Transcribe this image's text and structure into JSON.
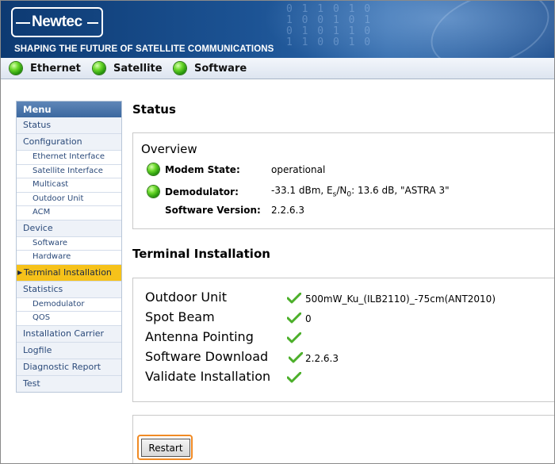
{
  "brand": {
    "logo": "Newtec",
    "tagline": "SHAPING THE FUTURE OF SATELLITE COMMUNICATIONS"
  },
  "status_strip": [
    {
      "label": "Ethernet",
      "state": "green"
    },
    {
      "label": "Satellite",
      "state": "green"
    },
    {
      "label": "Software",
      "state": "green"
    }
  ],
  "menu": {
    "title": "Menu",
    "items": [
      {
        "label": "Status",
        "level": 0
      },
      {
        "label": "Configuration",
        "level": 0
      },
      {
        "label": "Ethernet Interface",
        "level": 1
      },
      {
        "label": "Satellite Interface",
        "level": 1
      },
      {
        "label": "Multicast",
        "level": 1
      },
      {
        "label": "Outdoor Unit",
        "level": 1
      },
      {
        "label": "ACM",
        "level": 1
      },
      {
        "label": "Device",
        "level": 0
      },
      {
        "label": "Software",
        "level": 1
      },
      {
        "label": "Hardware",
        "level": 1
      },
      {
        "label": "Terminal Installation",
        "level": 0,
        "active": true
      },
      {
        "label": "Statistics",
        "level": 0
      },
      {
        "label": "Demodulator",
        "level": 1
      },
      {
        "label": "QOS",
        "level": 1
      },
      {
        "label": "Installation Carrier",
        "level": 0
      },
      {
        "label": "Logfile",
        "level": 0
      },
      {
        "label": "Diagnostic Report",
        "level": 0
      },
      {
        "label": "Test",
        "level": 0
      }
    ]
  },
  "status": {
    "heading": "Status",
    "overview_title": "Overview",
    "modem_state_label": "Modem State:",
    "modem_state_value": "operational",
    "demodulator_label": "Demodulator:",
    "demod_level": "-33.1 dBm,",
    "demod_es": "E",
    "demod_es_sub": "s",
    "demod_sep": "/N",
    "demod_n0_sub": "0",
    "demod_rest": ": 13.6 dB, \"ASTRA 3\"",
    "software_version_label": "Software Version:",
    "software_version_value": "2.2.6.3"
  },
  "terminal": {
    "heading": "Terminal Installation",
    "rows": [
      {
        "label": "Outdoor Unit",
        "value": "500mW_Ku_(ILB2110)_-75cm(ANT2010)"
      },
      {
        "label": "Spot Beam",
        "value": "0"
      },
      {
        "label": "Antenna Pointing",
        "value": ""
      },
      {
        "label": "Software Download",
        "value": "2.2.6.3"
      },
      {
        "label": "Validate Installation",
        "value": ""
      }
    ],
    "restart_label": "Restart"
  },
  "colors": {
    "led_green": "#3cb81a",
    "menu_active": "#f6c21a",
    "check_green": "#4caf2a",
    "restart_highlight": "#f08a24"
  }
}
